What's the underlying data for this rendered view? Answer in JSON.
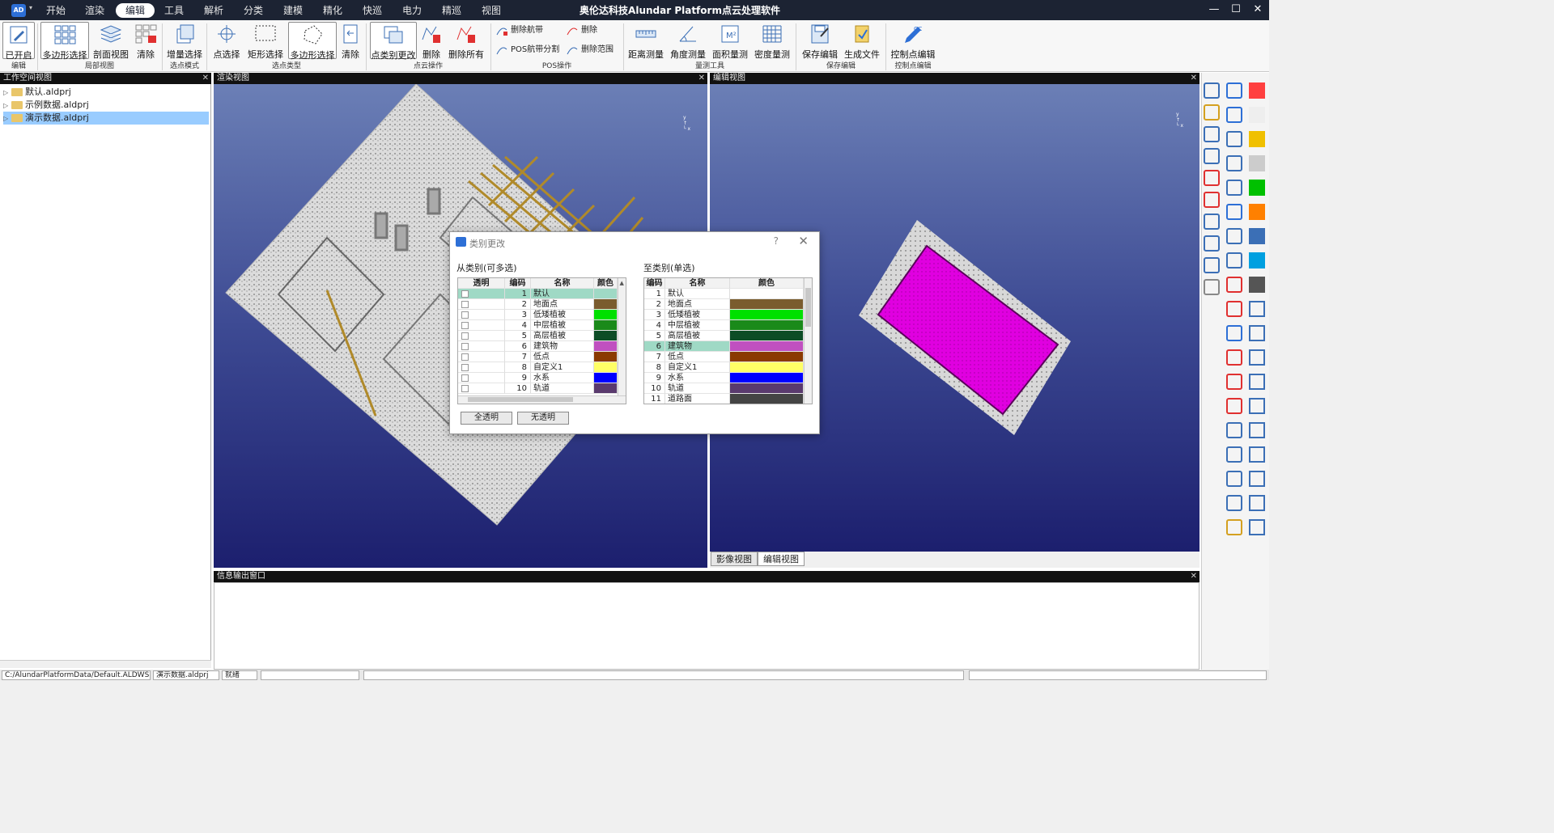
{
  "menu": {
    "tabs": [
      "开始",
      "渲染",
      "编辑",
      "工具",
      "解析",
      "分类",
      "建模",
      "精化",
      "快巡",
      "电力",
      "精巡",
      "视图"
    ],
    "active_index": 2
  },
  "app_title": "奥伦达科技Alundar Platform点云处理软件",
  "logo_text": "AD",
  "window": {
    "minimize": "—",
    "maximize": "☐",
    "close": "✕"
  },
  "ribbon": {
    "buttons": {
      "enabled": "已开启",
      "polygon_select": "多边形选择",
      "section_view": "剖面视图",
      "clear1": "清除",
      "incremental_select": "增量选择",
      "point_select": "点选择",
      "rect_select": "矩形选择",
      "polygon_select2": "多边形选择",
      "clear2": "清除",
      "point_class_change": "点类别更改",
      "delete": "删除",
      "delete_all": "删除所有",
      "distance": "距离测量",
      "angle": "角度测量",
      "area": "面积量测",
      "density": "密度量测",
      "save_edit": "保存编辑",
      "gen_file": "生成文件",
      "ctrl_edit": "控制点编辑"
    },
    "small": {
      "delete_flight": "删除航带",
      "delete": "删除",
      "pos_split": "POS航带分割",
      "delete_range": "删除范围"
    },
    "groups": {
      "edit": "编辑",
      "local_view": "局部视图",
      "select_mode": "选点模式",
      "select_type": "选点类型",
      "point_ops": "点云操作",
      "pos_ops": "POS操作",
      "measure": "量测工具",
      "save_edit": "保存编辑",
      "ctrl_edit": "控制点编辑"
    }
  },
  "workspace": {
    "title": "工作空间视图",
    "items": [
      "默认.aldprj",
      "示例数据.aldprj",
      "演示数据.aldprj"
    ],
    "selected_index": 2
  },
  "render_view": {
    "title": "渲染视图"
  },
  "edit_view": {
    "title": "编辑视图"
  },
  "info_output": {
    "title": "信息输出窗口"
  },
  "bottom_tabs": [
    "影像视图",
    "编辑视图"
  ],
  "status": {
    "path": "C:/AlundarPlatformData/Default.ALDWS",
    "project": "演示数据.aldprj",
    "state": "就绪"
  },
  "dialog": {
    "title": "类别更改",
    "help": "?",
    "close": "✕",
    "from_label": "从类别(可多选)",
    "to_label": "至类别(单选)",
    "from_headers": [
      "透明",
      "编码",
      "名称",
      "颜色"
    ],
    "to_headers": [
      "编码",
      "名称",
      "颜色"
    ],
    "from_rows": [
      {
        "code": "1",
        "name": "默认",
        "color": ""
      },
      {
        "code": "2",
        "name": "地面点",
        "color": "#7a5c2e"
      },
      {
        "code": "3",
        "name": "低矮植被",
        "color": "#00e000"
      },
      {
        "code": "4",
        "name": "中层植被",
        "color": "#1a8a1a"
      },
      {
        "code": "5",
        "name": "高层植被",
        "color": "#0d4d26"
      },
      {
        "code": "6",
        "name": "建筑物",
        "color": "#c050c0"
      },
      {
        "code": "7",
        "name": "低点",
        "color": "#8a3a00"
      },
      {
        "code": "8",
        "name": "自定义1",
        "color": "#ffff66"
      },
      {
        "code": "9",
        "name": "水系",
        "color": "#0000ff"
      },
      {
        "code": "10",
        "name": "轨道",
        "color": "#5a3a6e"
      }
    ],
    "to_rows": [
      {
        "code": "1",
        "name": "默认",
        "color": ""
      },
      {
        "code": "2",
        "name": "地面点",
        "color": "#7a5c2e"
      },
      {
        "code": "3",
        "name": "低矮植被",
        "color": "#00e000"
      },
      {
        "code": "4",
        "name": "中层植被",
        "color": "#1a8a1a"
      },
      {
        "code": "5",
        "name": "高层植被",
        "color": "#0d4d26"
      },
      {
        "code": "6",
        "name": "建筑物",
        "color": "#c050c0"
      },
      {
        "code": "7",
        "name": "低点",
        "color": "#8a3a00"
      },
      {
        "code": "8",
        "name": "自定义1",
        "color": "#ffff66"
      },
      {
        "code": "9",
        "name": "水系",
        "color": "#0000ff"
      },
      {
        "code": "10",
        "name": "轨道",
        "color": "#5a3a6e"
      },
      {
        "code": "11",
        "name": "道路面",
        "color": "#444444"
      }
    ],
    "from_selected_index": 0,
    "to_selected_index": 5,
    "btn_all": "全透明",
    "btn_none": "无透明"
  },
  "colors": {
    "titlebar": "#1c2333",
    "selection": "#9fd9c5",
    "building_edit": "#e000e0"
  }
}
